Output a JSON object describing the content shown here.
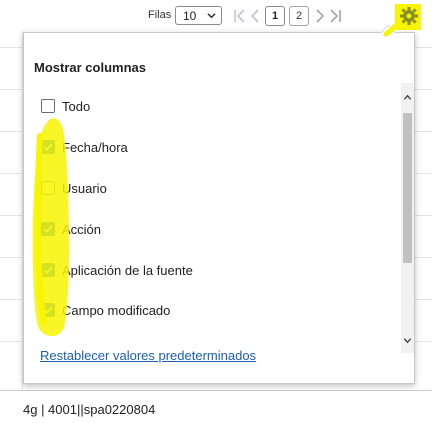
{
  "toolbar": {
    "rows_label": "Filas",
    "rows_value": "10",
    "pages": [
      "1",
      "2"
    ]
  },
  "panel": {
    "title": "Mostrar columnas",
    "options": [
      {
        "label": "Todo",
        "checked": false
      },
      {
        "label": "Fecha/hora",
        "checked": true
      },
      {
        "label": "Usuario",
        "checked": false
      },
      {
        "label": "Acción",
        "checked": true
      },
      {
        "label": "Aplicación de la fuente",
        "checked": true
      },
      {
        "label": "Campo modificado",
        "checked": true
      }
    ],
    "reset_label": "Restablecer valores predeterminados"
  },
  "footer": {
    "text": "4g | 4001||spa0220804"
  },
  "colors": {
    "accent": "#1a73e8",
    "link": "#1a5fb4",
    "annotation": "#f7f500"
  },
  "icons": {
    "first_page": "first-page-icon",
    "prev_page": "prev-page-icon",
    "next_page": "next-page-icon",
    "last_page": "last-page-icon",
    "settings": "gear-icon"
  }
}
